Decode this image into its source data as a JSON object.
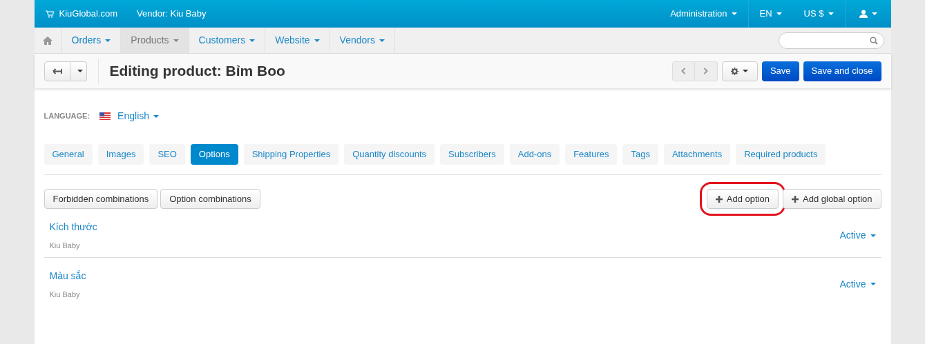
{
  "top_bar": {
    "store": "KiuGlobal.com",
    "vendor": "Vendor: Kiu Baby",
    "menus": [
      {
        "label": "Administration"
      },
      {
        "label": "EN"
      },
      {
        "label": "US $"
      }
    ]
  },
  "nav": {
    "items": [
      {
        "label": "Orders",
        "selected": false
      },
      {
        "label": "Products",
        "selected": true
      },
      {
        "label": "Customers",
        "selected": false
      },
      {
        "label": "Website",
        "selected": false
      },
      {
        "label": "Vendors",
        "selected": false
      }
    ]
  },
  "toolbar": {
    "title": "Editing product: Bỉm Boo",
    "buttons": [
      {
        "label": "Save"
      },
      {
        "label": "Save and close"
      }
    ]
  },
  "language": {
    "label": "LANGUAGE:",
    "value": "English"
  },
  "tabs": [
    {
      "label": "General",
      "selected": false
    },
    {
      "label": "Images",
      "selected": false
    },
    {
      "label": "SEO",
      "selected": false
    },
    {
      "label": "Options",
      "selected": true
    },
    {
      "label": "Shipping Properties",
      "selected": false
    },
    {
      "label": "Quantity discounts",
      "selected": false
    },
    {
      "label": "Subscribers",
      "selected": false
    },
    {
      "label": "Add-ons",
      "selected": false
    },
    {
      "label": "Features",
      "selected": false
    },
    {
      "label": "Tags",
      "selected": false
    },
    {
      "label": "Attachments",
      "selected": false
    },
    {
      "label": "Required products",
      "selected": false
    }
  ],
  "actions_left": [
    {
      "label": "Forbidden combinations"
    },
    {
      "label": "Option combinations"
    }
  ],
  "actions_right": [
    {
      "label": "Add option",
      "highlighted": true
    },
    {
      "label": "Add global option",
      "highlighted": false
    }
  ],
  "options": [
    {
      "name": "Kích thước",
      "vendor": "Kiu Baby",
      "status": "Active"
    },
    {
      "name": "Màu sắc",
      "vendor": "Kiu Baby",
      "status": "Active"
    }
  ]
}
